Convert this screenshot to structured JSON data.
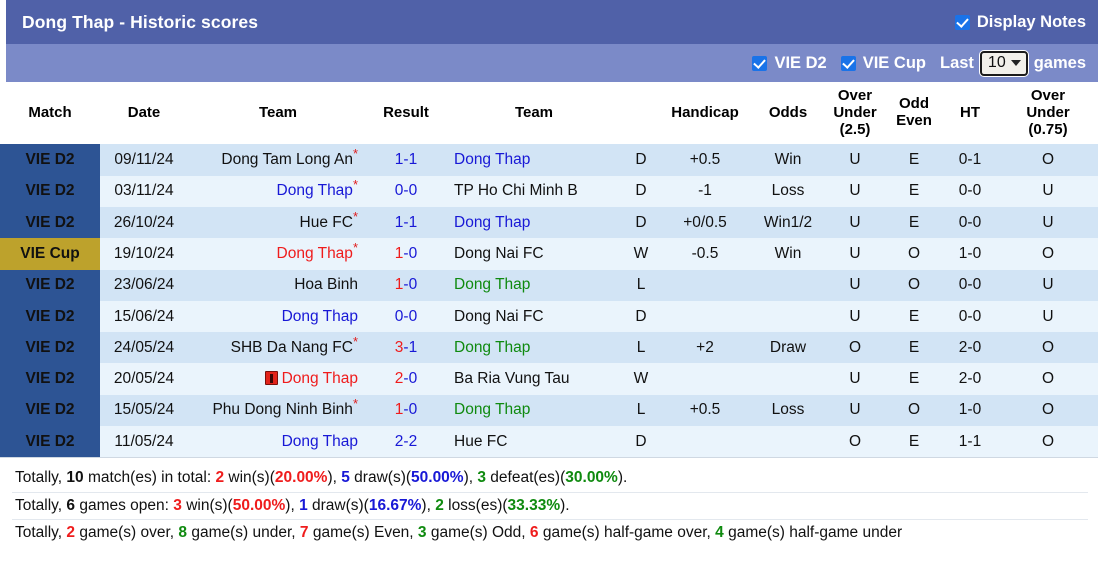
{
  "header": {
    "title": "Dong Thap - Historic scores",
    "display_notes_label": "Display Notes",
    "display_notes_checked": true,
    "filters": [
      {
        "label": "VIE D2",
        "checked": true
      },
      {
        "label": "VIE Cup",
        "checked": true
      }
    ],
    "last_label": "Last",
    "games_count": "10",
    "games_label": "games",
    "accent_title_bg": "#5061a8",
    "accent_filter_bg": "#7b8ac8",
    "checkbox_color": "#1a73e8"
  },
  "table": {
    "columns": [
      "Match",
      "Date",
      "Team",
      "Result",
      "Team",
      "",
      "Handicap",
      "Odds",
      "Over Under (2.5)",
      "Odd Even",
      "HT",
      "Over Under (0.75)"
    ],
    "column_lines": {
      "ou25": [
        "Over",
        "Under",
        "(2.5)"
      ],
      "oddeven": [
        "Odd",
        "Even"
      ],
      "ou075": [
        "Over",
        "Under",
        "(0.75)"
      ]
    },
    "badge_colors": {
      "VIE D2": "#2d5494",
      "VIE Cup": "#bda22c"
    },
    "rows": [
      {
        "match": "VIE D2",
        "match_type": "d2",
        "date": "09/11/24",
        "home": "Dong Tam Long An",
        "home_color": "black",
        "home_star": true,
        "home_redcard": false,
        "score_left": "1",
        "score_right": "-1",
        "score_left_color": "blue",
        "score_right_color": "blue",
        "away": "Dong Thap",
        "away_color": "blue",
        "away_star": false,
        "away_redcard": false,
        "wdl": "D",
        "wdl_color": "blue",
        "handicap": "+0.5",
        "odds": "Win",
        "odds_color": "red",
        "ou25": "U",
        "ou25_color": "green",
        "oddeven": "E",
        "oddeven_color": "red",
        "ht": "0-1",
        "ou075": "O",
        "ou075_color": "red"
      },
      {
        "match": "VIE D2",
        "match_type": "d2",
        "date": "03/11/24",
        "home": "Dong Thap",
        "home_color": "blue",
        "home_star": true,
        "home_redcard": false,
        "score_left": "0",
        "score_right": "-0",
        "score_left_color": "blue",
        "score_right_color": "blue",
        "away": "TP Ho Chi Minh B",
        "away_color": "black",
        "away_star": false,
        "away_redcard": false,
        "wdl": "D",
        "wdl_color": "blue",
        "handicap": "-1",
        "odds": "Loss",
        "odds_color": "green",
        "ou25": "U",
        "ou25_color": "green",
        "oddeven": "E",
        "oddeven_color": "red",
        "ht": "0-0",
        "ou075": "U",
        "ou075_color": "green"
      },
      {
        "match": "VIE D2",
        "match_type": "d2",
        "date": "26/10/24",
        "home": "Hue FC",
        "home_color": "black",
        "home_star": true,
        "home_redcard": false,
        "score_left": "1",
        "score_right": "-1",
        "score_left_color": "blue",
        "score_right_color": "blue",
        "away": "Dong Thap",
        "away_color": "blue",
        "away_star": false,
        "away_redcard": false,
        "wdl": "D",
        "wdl_color": "blue",
        "handicap": "+0/0.5",
        "odds": "Win1/2",
        "odds_color": "red",
        "ou25": "U",
        "ou25_color": "green",
        "oddeven": "E",
        "oddeven_color": "red",
        "ht": "0-0",
        "ou075": "U",
        "ou075_color": "green"
      },
      {
        "match": "VIE Cup",
        "match_type": "cup",
        "date": "19/10/24",
        "home": "Dong Thap",
        "home_color": "red",
        "home_star": true,
        "home_redcard": false,
        "score_left": "1",
        "score_right": "-0",
        "score_left_color": "red",
        "score_right_color": "blue",
        "away": "Dong Nai FC",
        "away_color": "black",
        "away_star": false,
        "away_redcard": false,
        "wdl": "W",
        "wdl_color": "red",
        "handicap": "-0.5",
        "odds": "Win",
        "odds_color": "red",
        "ou25": "U",
        "ou25_color": "green",
        "oddeven": "O",
        "oddeven_color": "green",
        "ht": "1-0",
        "ou075": "O",
        "ou075_color": "red"
      },
      {
        "match": "VIE D2",
        "match_type": "d2",
        "date": "23/06/24",
        "home": "Hoa Binh",
        "home_color": "black",
        "home_star": false,
        "home_redcard": false,
        "score_left": "1",
        "score_right": "-0",
        "score_left_color": "red",
        "score_right_color": "blue",
        "away": "Dong Thap",
        "away_color": "green",
        "away_star": false,
        "away_redcard": false,
        "wdl": "L",
        "wdl_color": "green",
        "handicap": "",
        "odds": "",
        "odds_color": "black",
        "ou25": "U",
        "ou25_color": "green",
        "oddeven": "O",
        "oddeven_color": "green",
        "ht": "0-0",
        "ou075": "U",
        "ou075_color": "green"
      },
      {
        "match": "VIE D2",
        "match_type": "d2",
        "date": "15/06/24",
        "home": "Dong Thap",
        "home_color": "blue",
        "home_star": false,
        "home_redcard": false,
        "score_left": "0",
        "score_right": "-0",
        "score_left_color": "blue",
        "score_right_color": "blue",
        "away": "Dong Nai FC",
        "away_color": "black",
        "away_star": false,
        "away_redcard": false,
        "wdl": "D",
        "wdl_color": "blue",
        "handicap": "",
        "odds": "",
        "odds_color": "black",
        "ou25": "U",
        "ou25_color": "green",
        "oddeven": "E",
        "oddeven_color": "red",
        "ht": "0-0",
        "ou075": "U",
        "ou075_color": "green"
      },
      {
        "match": "VIE D2",
        "match_type": "d2",
        "date": "24/05/24",
        "home": "SHB Da Nang FC",
        "home_color": "black",
        "home_star": true,
        "home_redcard": false,
        "score_left": "3",
        "score_right": "-1",
        "score_left_color": "red",
        "score_right_color": "blue",
        "away": "Dong Thap",
        "away_color": "green",
        "away_star": false,
        "away_redcard": false,
        "wdl": "L",
        "wdl_color": "green",
        "handicap": "+2",
        "odds": "Draw",
        "odds_color": "blue",
        "ou25": "O",
        "ou25_color": "red",
        "oddeven": "E",
        "oddeven_color": "red",
        "ht": "2-0",
        "ou075": "O",
        "ou075_color": "red"
      },
      {
        "match": "VIE D2",
        "match_type": "d2",
        "date": "20/05/24",
        "home": "Dong Thap",
        "home_color": "red",
        "home_star": false,
        "home_redcard": true,
        "score_left": "2",
        "score_right": "-0",
        "score_left_color": "red",
        "score_right_color": "blue",
        "away": "Ba Ria Vung Tau",
        "away_color": "black",
        "away_star": false,
        "away_redcard": false,
        "wdl": "W",
        "wdl_color": "red",
        "handicap": "",
        "odds": "",
        "odds_color": "black",
        "ou25": "U",
        "ou25_color": "green",
        "oddeven": "E",
        "oddeven_color": "red",
        "ht": "2-0",
        "ou075": "O",
        "ou075_color": "red"
      },
      {
        "match": "VIE D2",
        "match_type": "d2",
        "date": "15/05/24",
        "home": "Phu Dong Ninh Binh",
        "home_color": "black",
        "home_star": true,
        "home_redcard": false,
        "score_left": "1",
        "score_right": "-0",
        "score_left_color": "red",
        "score_right_color": "blue",
        "away": "Dong Thap",
        "away_color": "green",
        "away_star": false,
        "away_redcard": false,
        "wdl": "L",
        "wdl_color": "green",
        "handicap": "+0.5",
        "odds": "Loss",
        "odds_color": "green",
        "ou25": "U",
        "ou25_color": "green",
        "oddeven": "O",
        "oddeven_color": "green",
        "ht": "1-0",
        "ou075": "O",
        "ou075_color": "red"
      },
      {
        "match": "VIE D2",
        "match_type": "d2",
        "date": "11/05/24",
        "home": "Dong Thap",
        "home_color": "blue",
        "home_star": false,
        "home_redcard": false,
        "score_left": "2",
        "score_right": "-2",
        "score_left_color": "blue",
        "score_right_color": "blue",
        "away": "Hue FC",
        "away_color": "black",
        "away_star": false,
        "away_redcard": false,
        "wdl": "D",
        "wdl_color": "blue",
        "handicap": "",
        "odds": "",
        "odds_color": "black",
        "ou25": "O",
        "ou25_color": "red",
        "oddeven": "E",
        "oddeven_color": "red",
        "ht": "1-1",
        "ou075": "O",
        "ou075_color": "red"
      }
    ]
  },
  "summary": [
    [
      {
        "t": "Totally, ",
        "c": "black",
        "b": false
      },
      {
        "t": "10",
        "c": "black",
        "b": true
      },
      {
        "t": " match(es) in total: ",
        "c": "black",
        "b": false
      },
      {
        "t": "2",
        "c": "red",
        "b": true
      },
      {
        "t": " win(s)(",
        "c": "black",
        "b": false
      },
      {
        "t": "20.00%",
        "c": "red",
        "b": true
      },
      {
        "t": "), ",
        "c": "black",
        "b": false
      },
      {
        "t": "5",
        "c": "blue",
        "b": true
      },
      {
        "t": " draw(s)(",
        "c": "black",
        "b": false
      },
      {
        "t": "50.00%",
        "c": "blue",
        "b": true
      },
      {
        "t": "), ",
        "c": "black",
        "b": false
      },
      {
        "t": "3",
        "c": "green",
        "b": true
      },
      {
        "t": " defeat(es)(",
        "c": "black",
        "b": false
      },
      {
        "t": "30.00%",
        "c": "green",
        "b": true
      },
      {
        "t": ").",
        "c": "black",
        "b": false
      }
    ],
    [
      {
        "t": "Totally, ",
        "c": "black",
        "b": false
      },
      {
        "t": "6",
        "c": "black",
        "b": true
      },
      {
        "t": " games open: ",
        "c": "black",
        "b": false
      },
      {
        "t": "3",
        "c": "red",
        "b": true
      },
      {
        "t": " win(s)(",
        "c": "black",
        "b": false
      },
      {
        "t": "50.00%",
        "c": "red",
        "b": true
      },
      {
        "t": "), ",
        "c": "black",
        "b": false
      },
      {
        "t": "1",
        "c": "blue",
        "b": true
      },
      {
        "t": " draw(s)(",
        "c": "black",
        "b": false
      },
      {
        "t": "16.67%",
        "c": "blue",
        "b": true
      },
      {
        "t": "), ",
        "c": "black",
        "b": false
      },
      {
        "t": "2",
        "c": "green",
        "b": true
      },
      {
        "t": " loss(es)(",
        "c": "black",
        "b": false
      },
      {
        "t": "33.33%",
        "c": "green",
        "b": true
      },
      {
        "t": ").",
        "c": "black",
        "b": false
      }
    ],
    [
      {
        "t": "Totally, ",
        "c": "black",
        "b": false
      },
      {
        "t": "2",
        "c": "red",
        "b": true
      },
      {
        "t": " game(s) over, ",
        "c": "black",
        "b": false
      },
      {
        "t": "8",
        "c": "green",
        "b": true
      },
      {
        "t": " game(s) under, ",
        "c": "black",
        "b": false
      },
      {
        "t": "7",
        "c": "red",
        "b": true
      },
      {
        "t": " game(s) Even, ",
        "c": "black",
        "b": false
      },
      {
        "t": "3",
        "c": "green",
        "b": true
      },
      {
        "t": " game(s) Odd, ",
        "c": "black",
        "b": false
      },
      {
        "t": "6",
        "c": "red",
        "b": true
      },
      {
        "t": " game(s) half-game over, ",
        "c": "black",
        "b": false
      },
      {
        "t": "4",
        "c": "green",
        "b": true
      },
      {
        "t": " game(s) half-game under",
        "c": "black",
        "b": false
      }
    ]
  ]
}
